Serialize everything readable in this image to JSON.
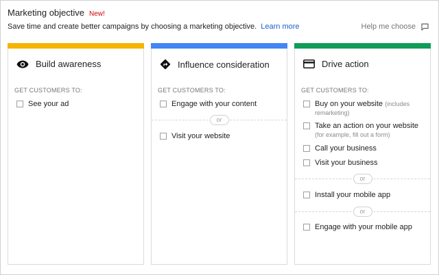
{
  "header": {
    "title": "Marketing objective",
    "badge": "New!",
    "subtitle": "Save time and create better campaigns by choosing a marketing objective.",
    "learn_more": "Learn more",
    "help": "Help me choose"
  },
  "colors": {
    "awareness": "#f4b400",
    "consideration": "#4285f4",
    "action": "#0f9d58",
    "link": "#1a5fd0",
    "badge": "#d50000"
  },
  "cards": [
    {
      "name": "Build awareness",
      "icon": "eye-icon",
      "sub_label": "GET CUSTOMERS TO:",
      "options": [
        "See your ad"
      ]
    },
    {
      "name": "Influence consideration",
      "icon": "direction-sign-icon",
      "sub_label": "GET CUSTOMERS TO:",
      "options": [
        "Engage with your content",
        "Visit your website"
      ],
      "divider": "or"
    },
    {
      "name": "Drive action",
      "icon": "credit-card-icon",
      "sub_label": "GET CUSTOMERS TO:",
      "options": [
        {
          "label": "Buy on your website",
          "note": "(includes",
          "note_line2": "remarketing)"
        },
        {
          "label": "Take an action on your website",
          "note_line2": "(for example, fill out a form)"
        },
        {
          "label": "Call your business"
        },
        {
          "label": "Visit your business"
        },
        {
          "label": "Install your mobile app"
        },
        {
          "label": "Engage with your mobile app"
        }
      ],
      "divider": "or"
    }
  ]
}
